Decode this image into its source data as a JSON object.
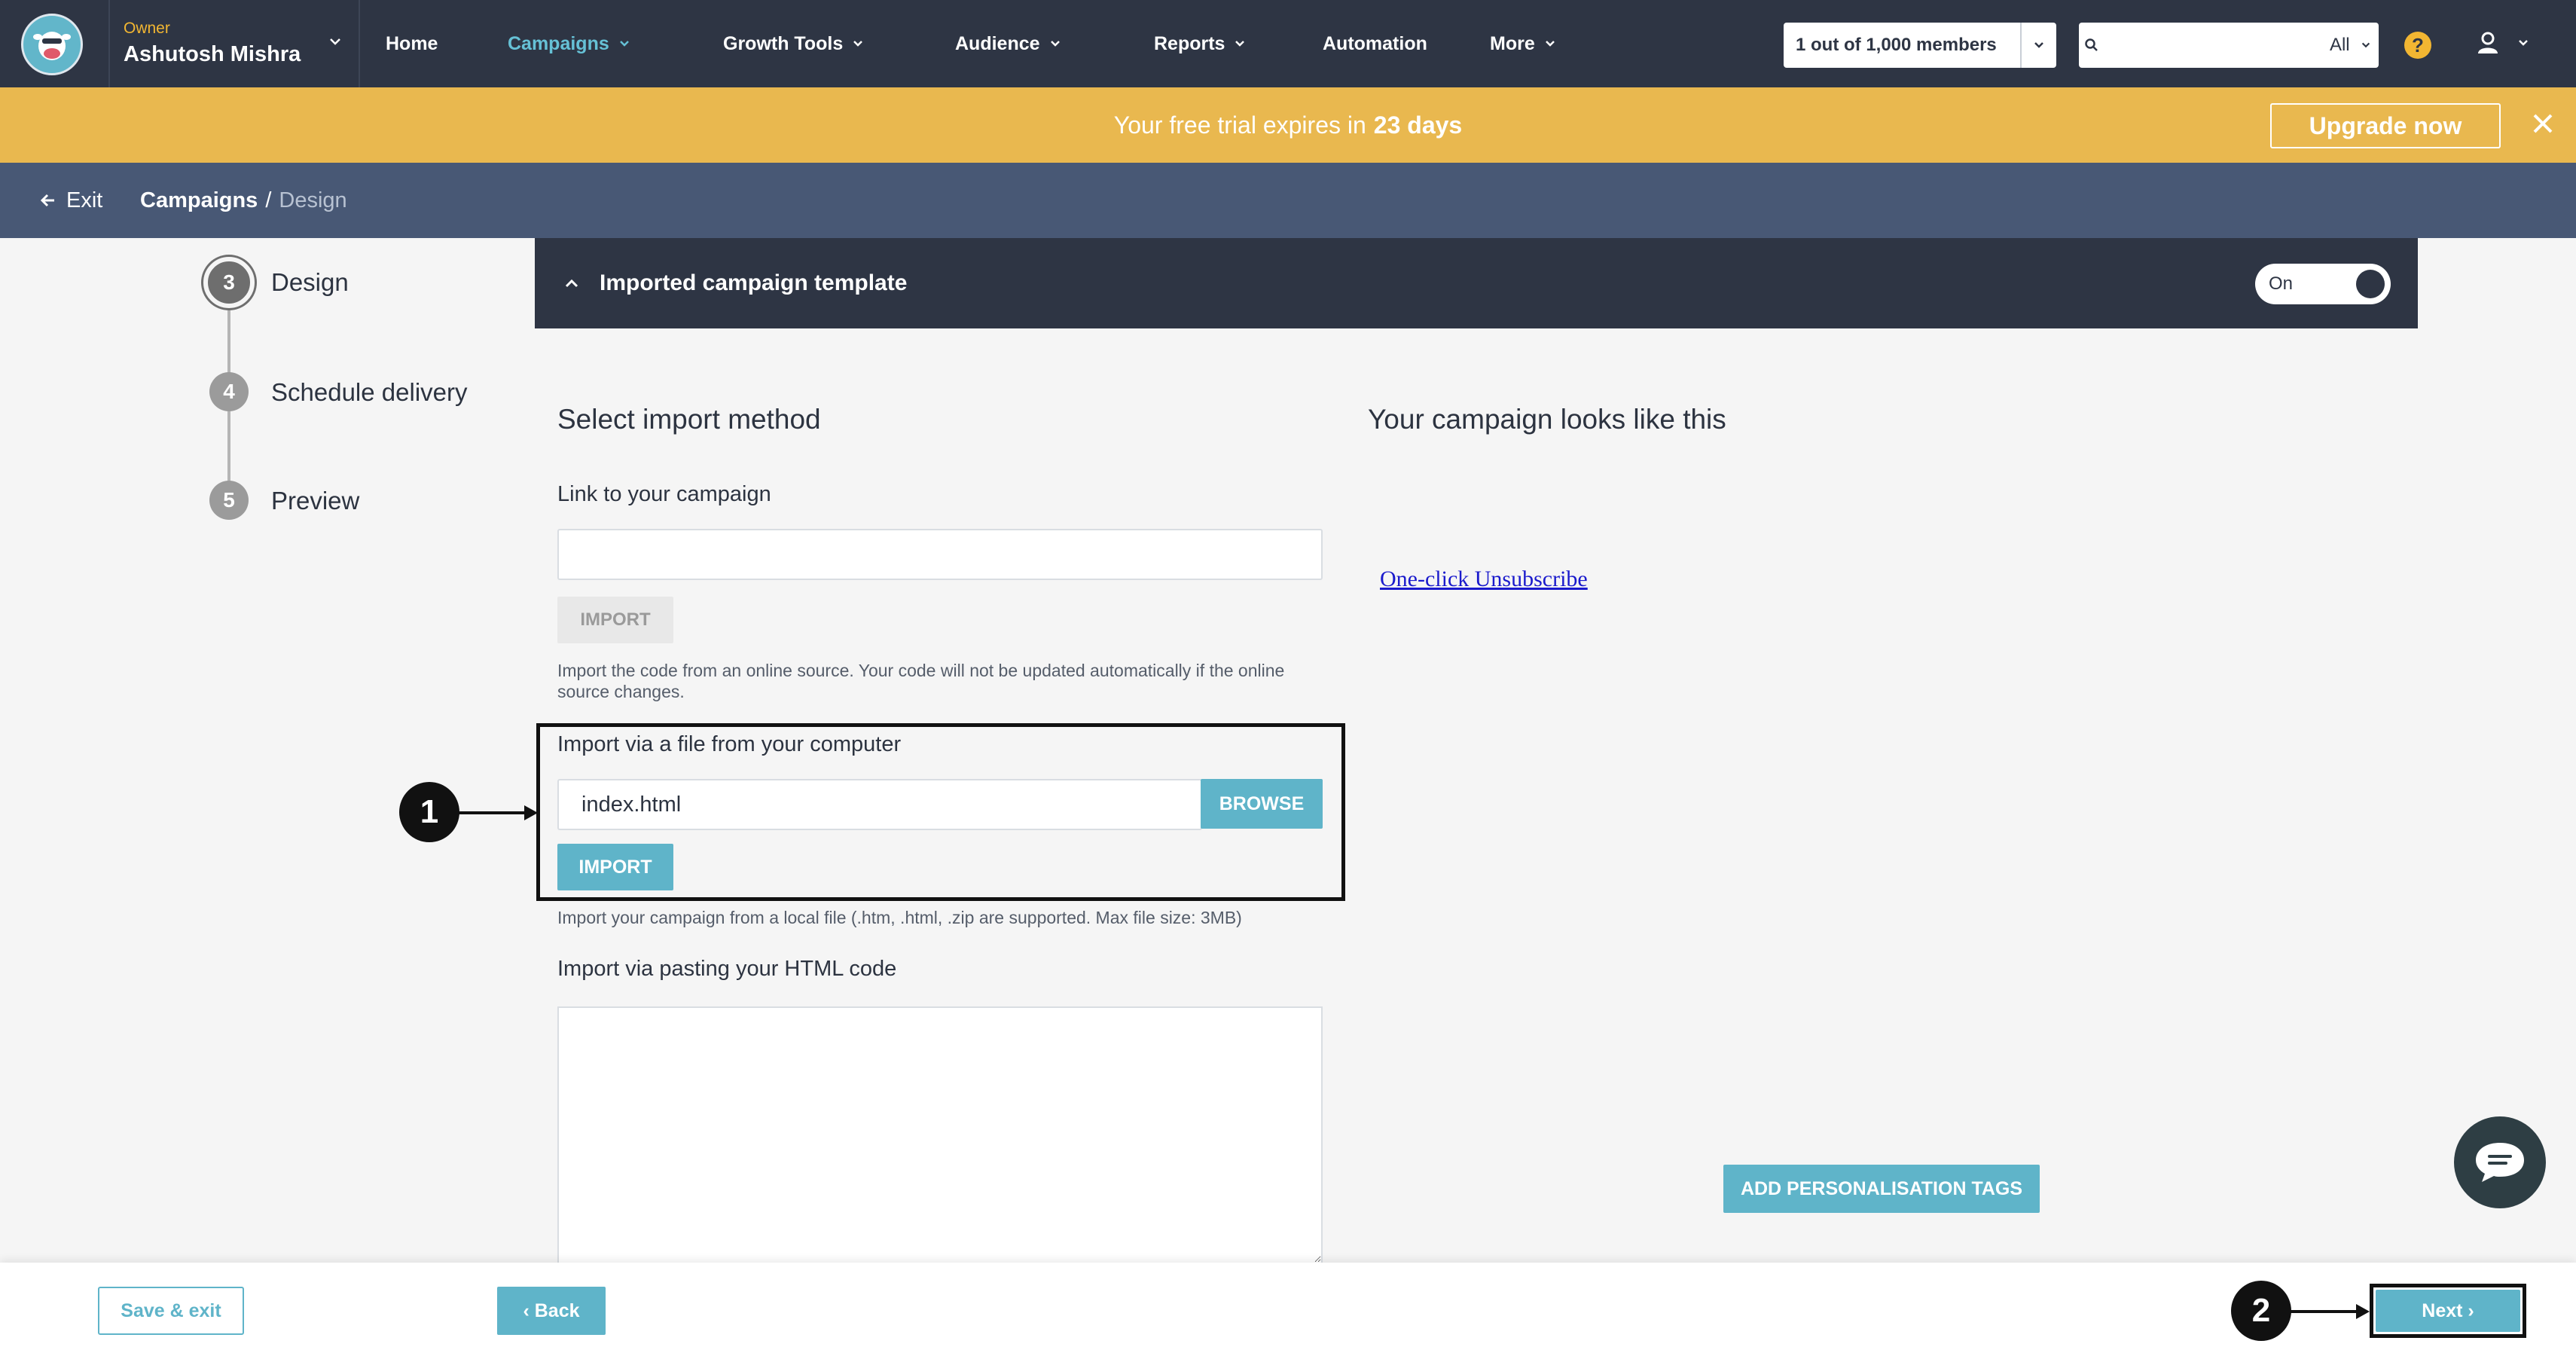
{
  "topnav": {
    "owner_role": "Owner",
    "owner_name": "Ashutosh Mishra",
    "items": [
      {
        "label": "Home",
        "active": false,
        "has_menu": false
      },
      {
        "label": "Campaigns",
        "active": true,
        "has_menu": true
      },
      {
        "label": "Growth Tools",
        "active": false,
        "has_menu": true
      },
      {
        "label": "Audience",
        "active": false,
        "has_menu": true
      },
      {
        "label": "Reports",
        "active": false,
        "has_menu": true
      },
      {
        "label": "Automation",
        "active": false,
        "has_menu": false
      },
      {
        "label": "More",
        "active": false,
        "has_menu": true
      }
    ],
    "members_label": "1 out of 1,000 members",
    "search": {
      "placeholder": "",
      "scope": "All"
    },
    "help_icon": "?",
    "colors": {
      "bg": "#2e3544",
      "active": "#66c1d6",
      "accent": "#f2b632"
    }
  },
  "trial_banner": {
    "text": "Your free trial expires in",
    "days": "23 days",
    "upgrade_label": "Upgrade now",
    "color": "#e9b84f"
  },
  "breadcrumb": {
    "exit_label": "Exit",
    "root": "Campaigns",
    "separator": "/",
    "current": "Design"
  },
  "steps": [
    {
      "number": "3",
      "label": "Design",
      "current": true
    },
    {
      "number": "4",
      "label": "Schedule delivery",
      "current": false
    },
    {
      "number": "5",
      "label": "Preview",
      "current": false
    }
  ],
  "template_panel": {
    "title": "Imported campaign template",
    "toggle_label": "On",
    "toggle_on": true
  },
  "import": {
    "heading": "Select import method",
    "link": {
      "label": "Link to your campaign",
      "value": "",
      "import_label": "IMPORT",
      "hint": "Import the code from an online source. Your code will not be updated automatically if the online source changes."
    },
    "file": {
      "label": "Import via a file from your computer",
      "value": "index.html",
      "browse_label": "BROWSE",
      "import_label": "IMPORT",
      "hint": "Import your campaign from a local file (.htm, .html, .zip are supported. Max file size: 3MB)"
    },
    "paste": {
      "label": "Import via pasting your HTML code",
      "value": ""
    }
  },
  "preview": {
    "heading": "Your campaign looks like this",
    "unsubscribe_link": "One-click Unsubscribe",
    "personalisation_label": "ADD PERSONALISATION TAGS"
  },
  "callouts": [
    "1",
    "2"
  ],
  "footer": {
    "save_exit_label": "Save & exit",
    "back_label": "‹ Back",
    "next_label": "Next ›",
    "accent": "#5fb4c9"
  }
}
